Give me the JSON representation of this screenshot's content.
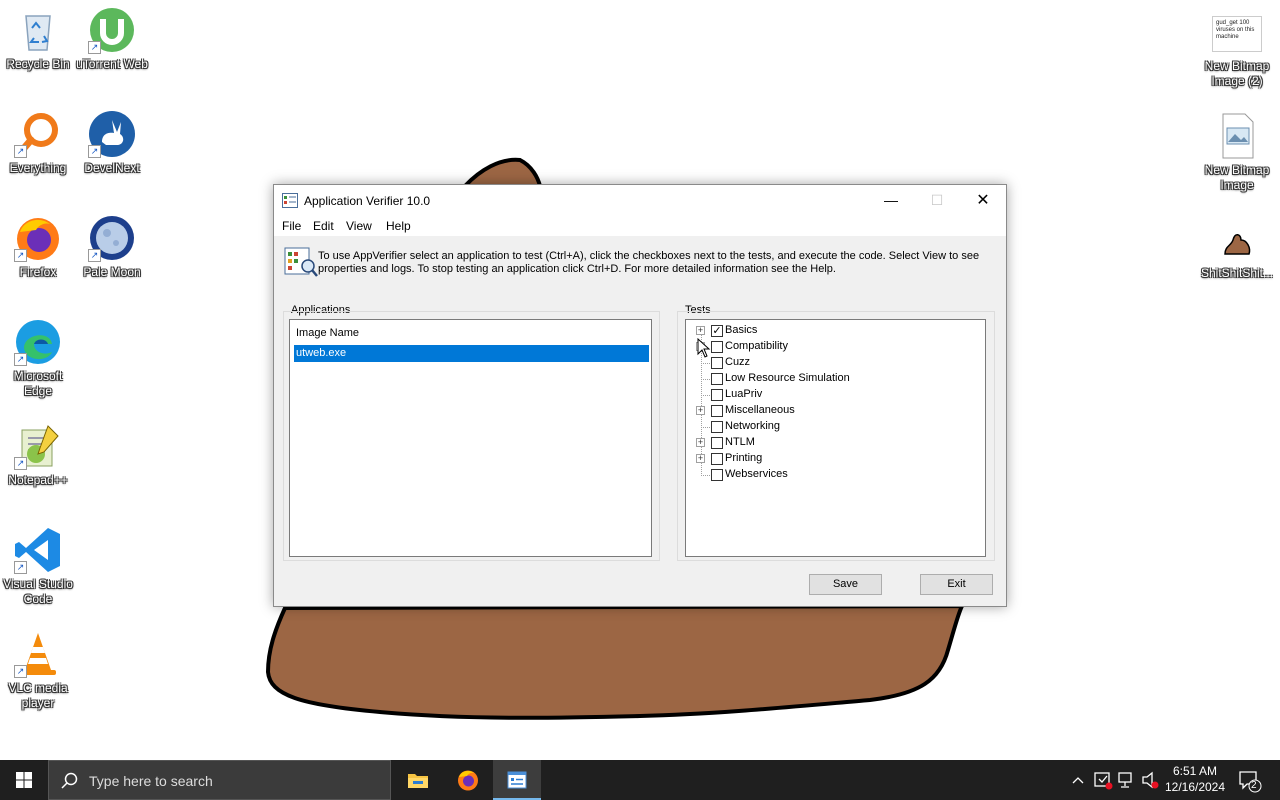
{
  "desktop": {
    "icons": [
      {
        "label": "Recycle Bin"
      },
      {
        "label": "uTorrent Web"
      },
      {
        "label": "Everything"
      },
      {
        "label": "DevelNext"
      },
      {
        "label": "Firefox"
      },
      {
        "label": "Pale Moon"
      },
      {
        "label": "Microsoft Edge"
      },
      {
        "label": "Notepad++"
      },
      {
        "label": "Visual Studio Code"
      },
      {
        "label": "VLC media player"
      },
      {
        "label": "New Bitmap Image (2)",
        "thumb_text": "gud_get 100 viruses on this machine"
      },
      {
        "label": "New Bitmap Image"
      },
      {
        "label": "ShitShitShit..."
      }
    ]
  },
  "dialog": {
    "title": "Application Verifier 10.0",
    "menu": [
      "File",
      "Edit",
      "View",
      "Help"
    ],
    "info": "To use AppVerifier select an application to test (Ctrl+A), click the checkboxes next to the tests, and execute the code. Select View to see properties and logs. To stop testing an application click Ctrl+D. For more detailed information see the Help.",
    "applications": {
      "group_label": "Applications",
      "column_header": "Image Name",
      "rows": [
        "utweb.exe"
      ]
    },
    "tests": {
      "group_label": "Tests",
      "items": [
        {
          "label": "Basics",
          "checked": true,
          "expandable": true
        },
        {
          "label": "Compatibility",
          "checked": false,
          "expandable": true
        },
        {
          "label": "Cuzz",
          "checked": false,
          "expandable": false
        },
        {
          "label": "Low Resource Simulation",
          "checked": false,
          "expandable": false
        },
        {
          "label": "LuaPriv",
          "checked": false,
          "expandable": false
        },
        {
          "label": "Miscellaneous",
          "checked": false,
          "expandable": true
        },
        {
          "label": "Networking",
          "checked": false,
          "expandable": false
        },
        {
          "label": "NTLM",
          "checked": false,
          "expandable": true
        },
        {
          "label": "Printing",
          "checked": false,
          "expandable": true
        },
        {
          "label": "Webservices",
          "checked": false,
          "expandable": false
        }
      ]
    },
    "buttons": {
      "save": "Save",
      "exit": "Exit"
    }
  },
  "taskbar": {
    "search_placeholder": "Type here to search",
    "clock_time": "6:51 AM",
    "clock_date": "12/16/2024",
    "notification_count": "2"
  },
  "colors": {
    "selection": "#0078d7",
    "taskbar": "#1f1f1f",
    "blob_fill": "#9c6644"
  }
}
